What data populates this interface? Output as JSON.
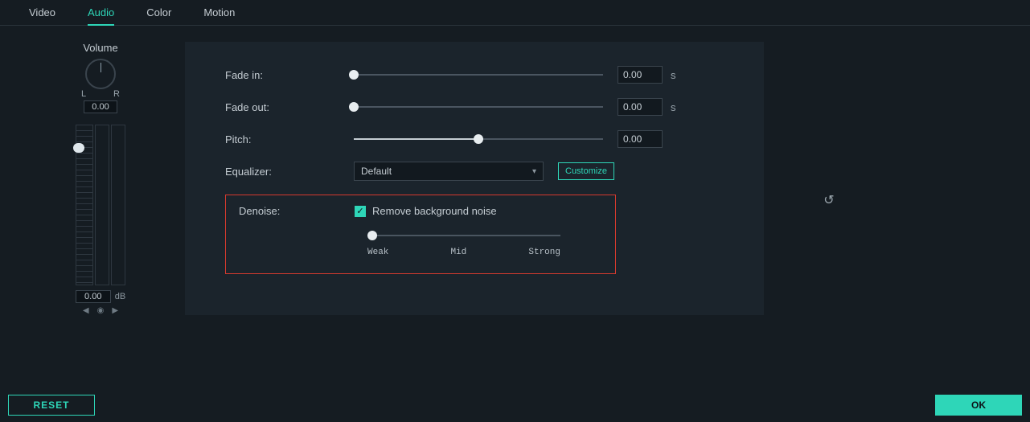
{
  "tabs": [
    "Video",
    "Audio",
    "Color",
    "Motion"
  ],
  "active_tab": 1,
  "volume": {
    "label": "Volume",
    "left_mark": "L",
    "right_mark": "R",
    "pan_value": "0.00",
    "db_value": "0.00",
    "db_unit": "dB"
  },
  "controls": {
    "fade_in": {
      "label": "Fade in:",
      "value": "0.00",
      "unit": "s",
      "pct": 0
    },
    "fade_out": {
      "label": "Fade out:",
      "value": "0.00",
      "unit": "s",
      "pct": 0
    },
    "pitch": {
      "label": "Pitch:",
      "value": "0.00",
      "pct": 50
    },
    "equalizer": {
      "label": "Equalizer:",
      "selected": "Default",
      "customize": "Customize"
    },
    "denoise": {
      "label": "Denoise:",
      "checkbox_label": "Remove background noise",
      "checked": true,
      "strength_pct": 0,
      "strength_labels": [
        "Weak",
        "Mid",
        "Strong"
      ]
    }
  },
  "footer": {
    "reset": "RESET",
    "ok": "OK"
  }
}
